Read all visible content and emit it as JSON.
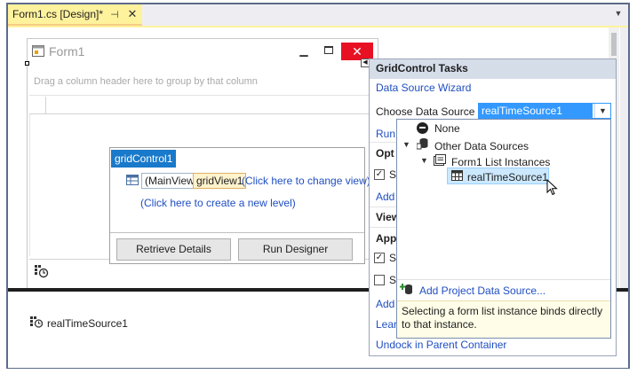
{
  "tab": {
    "title": "Form1.cs [Design]*"
  },
  "form": {
    "title": "Form1"
  },
  "grid": {
    "group_panel_text": "Drag a column header here to group by that column",
    "control_name": "gridControl1",
    "main_view": "(MainView)",
    "grid_view": "gridView1",
    "change_view_link": "(Click here to change view)",
    "new_level_link": "(Click here to create a new level)",
    "retrieve_details": "Retrieve Details",
    "run_designer": "Run Designer"
  },
  "tray": {
    "component": "realTimeSource1"
  },
  "tasks": {
    "title": "GridControl Tasks",
    "wizard_link": "Data Source Wizard",
    "choose_label": "Choose Data Source",
    "combo_value": "realTimeSource1",
    "run_link_partial": "Run",
    "options_partial": "Opt",
    "add_link_partial": "Add",
    "views_partial": "View",
    "appearance_partial": "App",
    "check1_partial": "S",
    "check2_partial": "S",
    "add2_partial": "Add",
    "learn_partial": "Lear",
    "dock_link": "Undock in Parent Container"
  },
  "dropdown": {
    "none": "None",
    "other_sources": "Other Data Sources",
    "form_list": "Form1 List Instances",
    "selected_item": "realTimeSource1",
    "add_project_link": "Add Project Data Source...",
    "hint": "Selecting a form list instance binds directly to that instance."
  }
}
